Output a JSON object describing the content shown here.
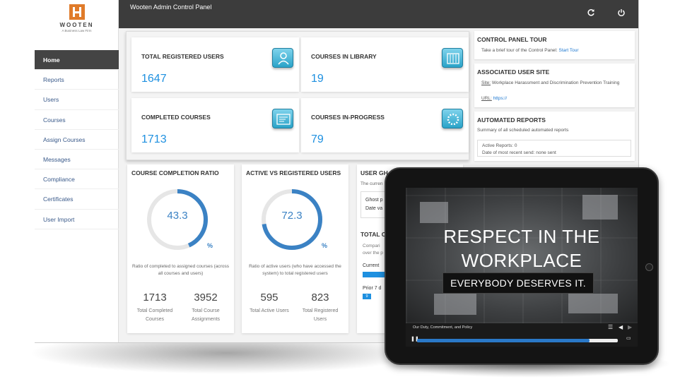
{
  "app": {
    "title": "Wooten Admin Control Panel",
    "logo_name": "WOOTEN",
    "logo_sub": "A Business Law Firm"
  },
  "nav": {
    "items": [
      {
        "label": "Home",
        "active": true
      },
      {
        "label": "Reports"
      },
      {
        "label": "Users"
      },
      {
        "label": "Courses"
      },
      {
        "label": "Assign Courses"
      },
      {
        "label": "Messages"
      },
      {
        "label": "Compliance"
      },
      {
        "label": "Certificates"
      },
      {
        "label": "User Import"
      }
    ]
  },
  "topbar": {
    "refresh_icon": "refresh-icon",
    "power_icon": "power-icon"
  },
  "stats": [
    {
      "label": "TOTAL REGISTERED USERS",
      "value": "1647",
      "icon": "user-profile-icon"
    },
    {
      "label": "COURSES IN LIBRARY",
      "value": "19",
      "icon": "library-icon"
    },
    {
      "label": "COMPLETED COURSES",
      "value": "1713",
      "icon": "certificate-icon"
    },
    {
      "label": "COURSES IN-PROGRESS",
      "value": "79",
      "icon": "progress-spinner-icon"
    }
  ],
  "gauges": [
    {
      "title": "COURSE COMPLETION RATIO",
      "value": "43.3",
      "percent": 43.3,
      "unit": "%",
      "description": "Ratio of completed to assigned courses (across all courses and users)",
      "left_num": "1713",
      "left_label": "Total Completed Courses",
      "right_num": "3952",
      "right_label": "Total Course Assignments"
    },
    {
      "title": "ACTIVE VS REGISTERED USERS",
      "value": "72.3",
      "percent": 72.3,
      "unit": "%",
      "description": "Ratio of active users (who have accessed the system) to total registered users",
      "left_num": "595",
      "left_label": "Total Active Users",
      "right_num": "823",
      "right_label": "Total Registered Users"
    }
  ],
  "ghost": {
    "title": "USER GH",
    "sub": "The curren",
    "line1": "Ghost p",
    "line2": "Date va",
    "total_title": "TOTAL C",
    "total_sub1": "Compari",
    "total_sub2": "over the p",
    "current": "Current",
    "prior": "Prior 7 d",
    "prior_badge": "9"
  },
  "right": {
    "tour_title": "CONTROL PANEL TOUR",
    "tour_text": "Take a brief tour of the Control Panel:",
    "tour_link": "Start Tour",
    "site_title": "ASSOCIATED USER SITE",
    "site_label": "Site:",
    "site_value": "Workplace Harassment and Discrimination Prevention Training",
    "url_label": "URL:",
    "url_value": "https://",
    "auto_title": "AUTOMATED REPORTS",
    "auto_sub": "Summary of all scheduled automated reports",
    "active_reports": "Active Reports: 0",
    "recent_send": "Date of most recent send: none sent"
  },
  "tablet": {
    "video_title_line1": "RESPECT IN THE",
    "video_title_line2": "WORKPLACE",
    "video_banner": "EVERYBODY DESERVES IT.",
    "player_title": "Our Duty, Commitment, and Policy",
    "progress": 0.86
  },
  "colors": {
    "accent_blue": "#1e90e0",
    "gauge_blue": "#3b82c4",
    "topbar": "#3c3c3c",
    "logo_orange": "#e07b2a"
  }
}
